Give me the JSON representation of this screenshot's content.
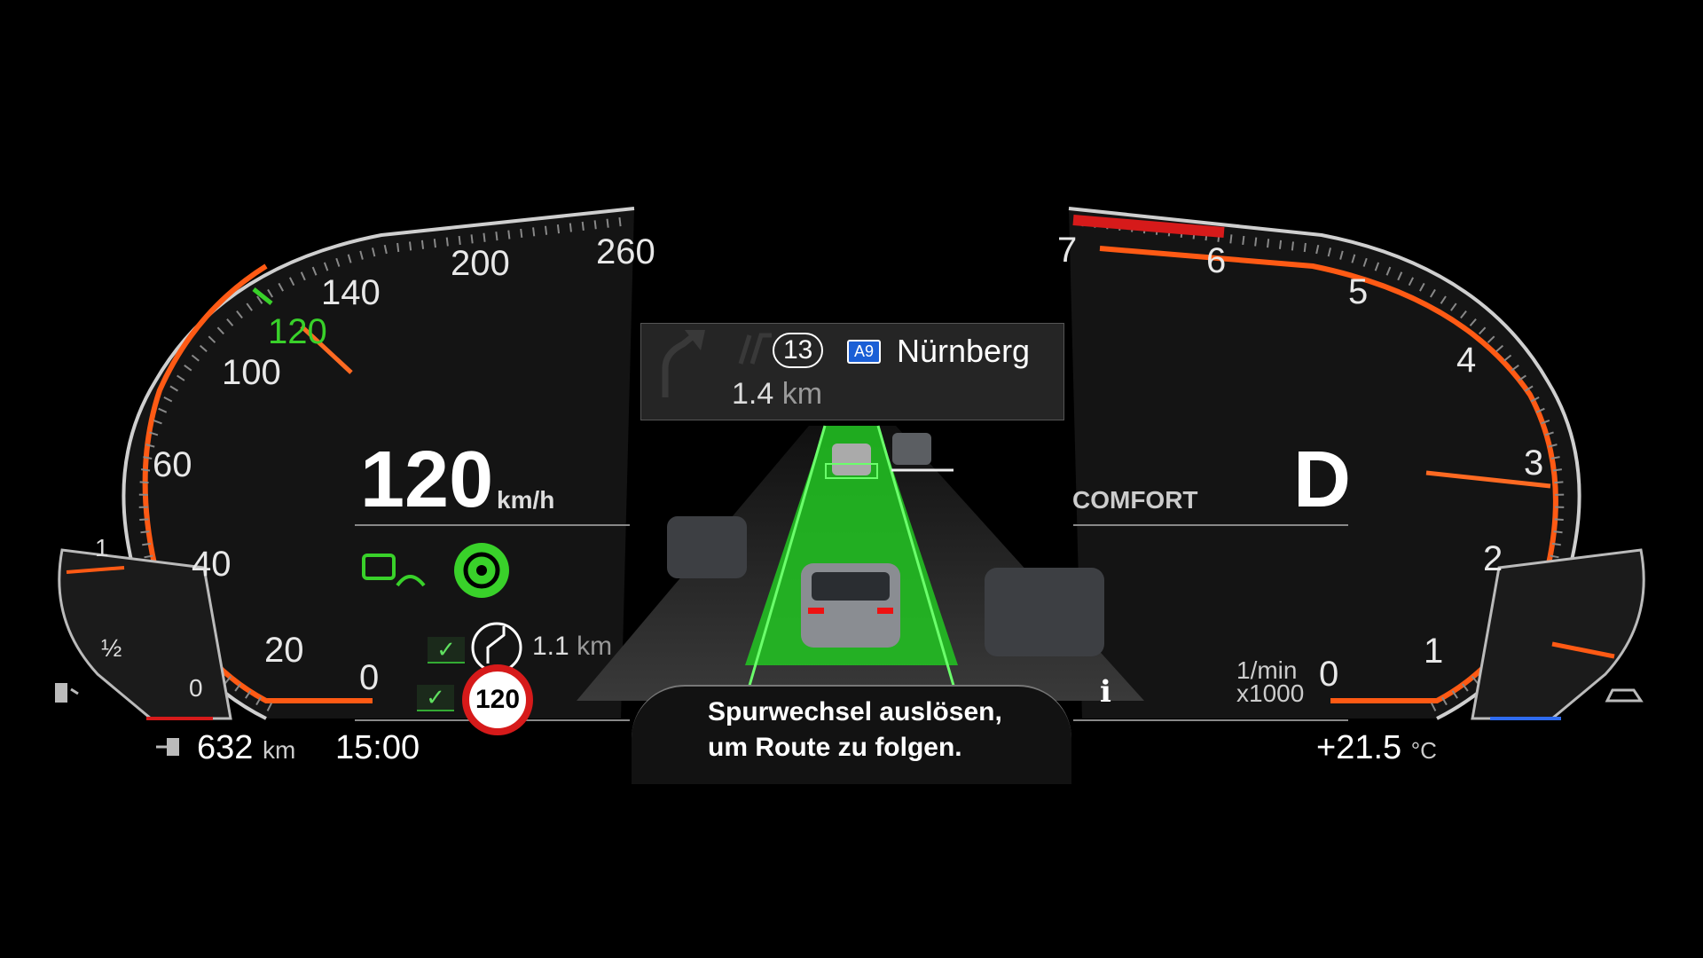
{
  "speedometer": {
    "ticks": [
      "0",
      "20",
      "40",
      "60",
      "100",
      "120",
      "140",
      "200",
      "260"
    ],
    "current_speed": "120",
    "speed_unit": "km/h",
    "set_speed_marker": "120",
    "accent_color": "#ff5a14",
    "set_speed_color": "#39d12a"
  },
  "tachometer": {
    "ticks": [
      "0",
      "1",
      "2",
      "3",
      "4",
      "5",
      "6",
      "7"
    ],
    "unit_line1": "1/min",
    "unit_line2": "x1000",
    "gear": "D",
    "drive_mode": "COMFORT"
  },
  "fuel_gauge": {
    "full_label": "1",
    "half_label": "½",
    "empty_label": "0"
  },
  "navigation": {
    "exit_number": "13",
    "motorway": "A9",
    "destination": "Nürnberg",
    "distance_value": "1.4",
    "distance_unit": "km"
  },
  "lane_change": {
    "distance_value": "1.1",
    "distance_unit": "km"
  },
  "speed_limit": {
    "value": "120"
  },
  "message": {
    "line1": "Spurwechsel auslösen,",
    "line2": "um Route zu folgen."
  },
  "status_bar": {
    "range_value": "632",
    "range_unit": "km",
    "time": "15:00",
    "temperature_value": "+21.5",
    "temperature_unit": "°C"
  },
  "info_icon": "i"
}
